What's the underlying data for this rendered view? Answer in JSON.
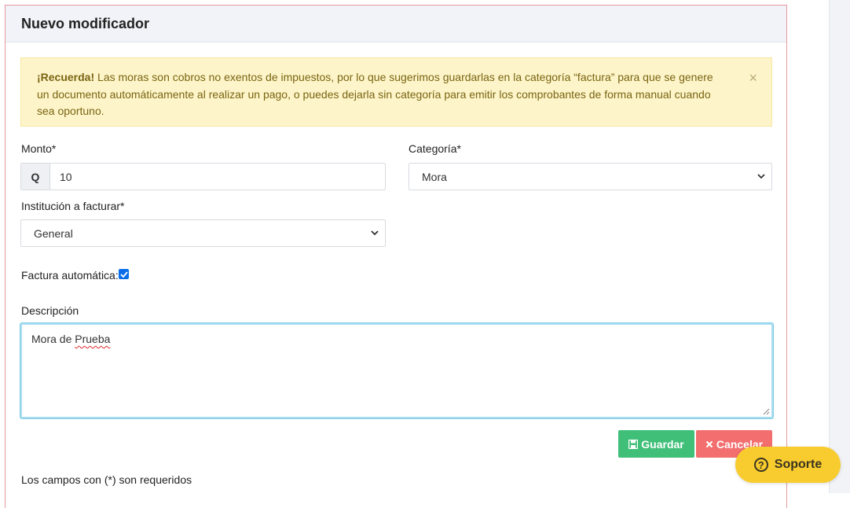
{
  "modal": {
    "title": "Nuevo modificador"
  },
  "alert": {
    "bold": "¡Recuerda!",
    "text": " Las moras son cobros no exentos de impuestos, por lo que sugerimos guardarlas en la categoría “factura” para que se genere un documento automáticamente al realizar un pago, o puedes dejarla sin categoría para emitir los comprobantes de forma manual cuando sea oportuno.",
    "close": "×"
  },
  "form": {
    "monto_label": "Monto*",
    "monto_prefix": "Q",
    "monto_value": "10",
    "categoria_label": "Categoría*",
    "categoria_value": "Mora",
    "institucion_label": "Institución a facturar*",
    "institucion_value": "General",
    "factura_label": "Factura automática:",
    "factura_checked": true,
    "descripcion_label": "Descripción",
    "descripcion_value_a": "Mora de ",
    "descripcion_value_b": "Prueba"
  },
  "buttons": {
    "save": "Guardar",
    "cancel": "Cancelar"
  },
  "footnote": "Los campos con (*) son requeridos",
  "support": {
    "label": "Soporte",
    "icon": "?"
  },
  "colors": {
    "save": "#3fbf78",
    "cancel": "#f36e6e",
    "support": "#f8cc2e",
    "alert_bg": "#fdf5c9"
  }
}
